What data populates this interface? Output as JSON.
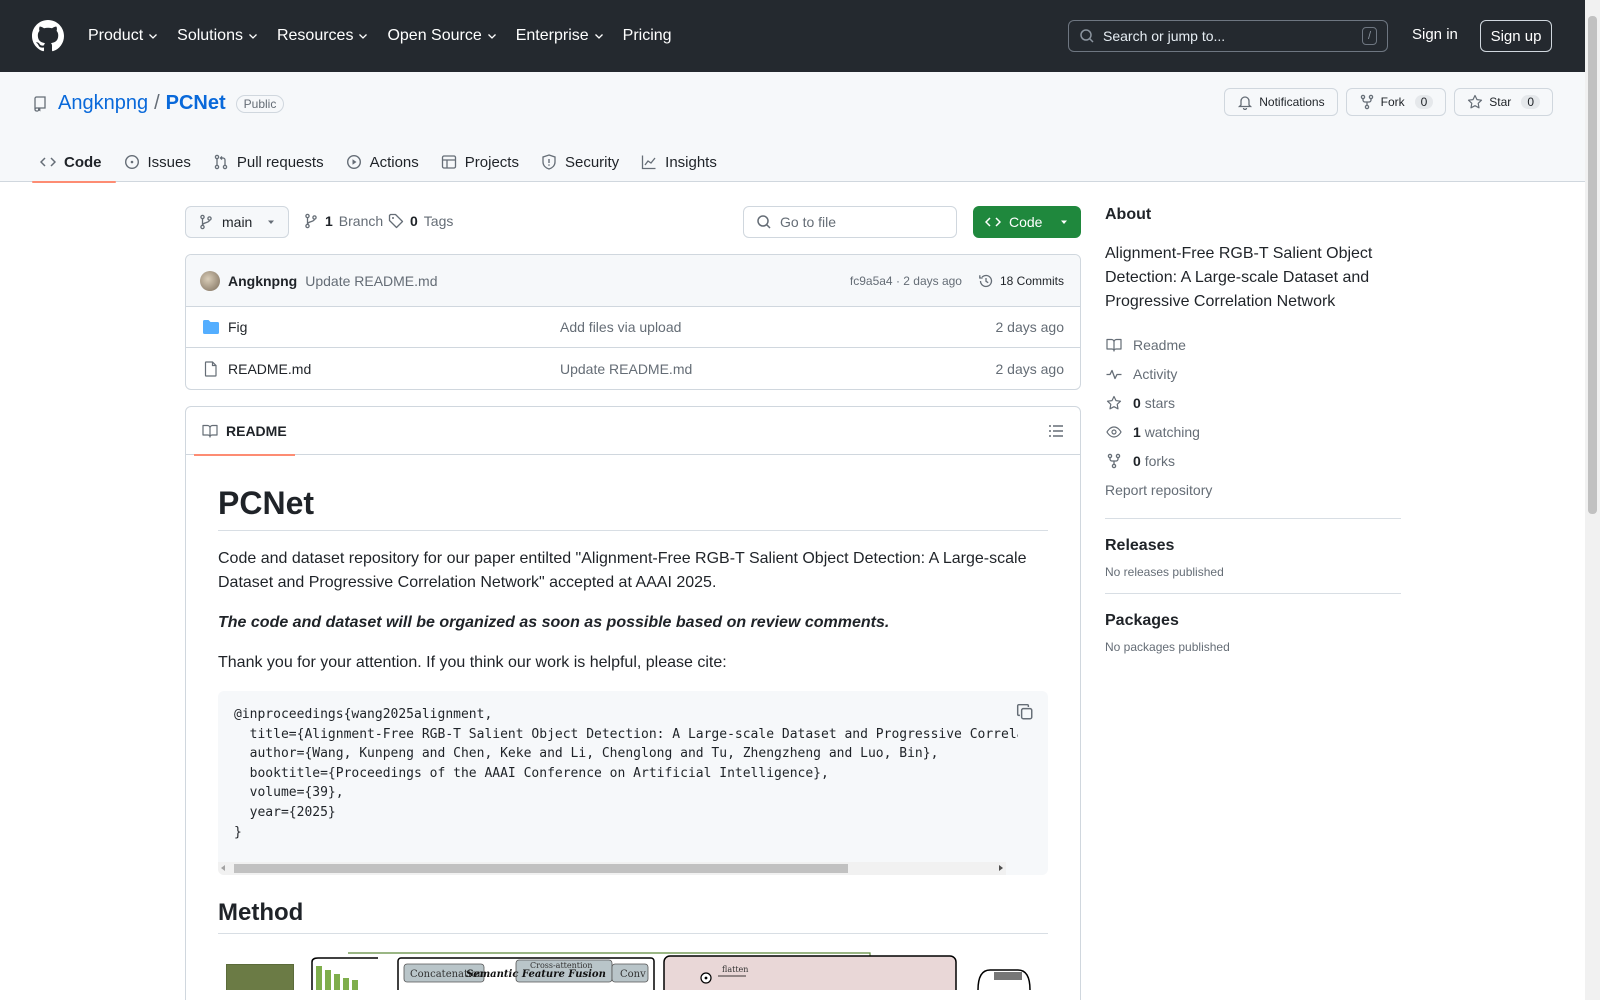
{
  "header": {
    "nav": [
      "Product",
      "Solutions",
      "Resources",
      "Open Source",
      "Enterprise",
      "Pricing"
    ],
    "search_placeholder": "Search or jump to...",
    "search_shortcut": "/",
    "sign_in": "Sign in",
    "sign_up": "Sign up"
  },
  "repo": {
    "owner": "Angknpng",
    "separator": "/",
    "name": "PCNet",
    "visibility": "Public",
    "notifications_label": "Notifications",
    "fork_label": "Fork",
    "fork_count": "0",
    "star_label": "Star",
    "star_count": "0",
    "tabs": [
      "Code",
      "Issues",
      "Pull requests",
      "Actions",
      "Projects",
      "Security",
      "Insights"
    ]
  },
  "toolbar": {
    "branch": "main",
    "branch_count": "1",
    "branch_label": "Branch",
    "tag_count": "0",
    "tag_label": "Tags",
    "goto_placeholder": "Go to file",
    "code_button": "Code"
  },
  "latest_commit": {
    "author": "Angknpng",
    "message": "Update README.md",
    "hash_time": "fc9a5a4 · 2 days ago",
    "commits": "18 Commits"
  },
  "files": [
    {
      "name": "Fig",
      "type": "folder",
      "commit": "Add files via upload",
      "date": "2 days ago"
    },
    {
      "name": "README.md",
      "type": "file",
      "commit": "Update README.md",
      "date": "2 days ago"
    }
  ],
  "readme": {
    "tab_label": "README",
    "title": "PCNet",
    "intro": "Code and dataset repository for our paper entilted \"Alignment-Free RGB-T Salient Object Detection: A Large-scale Dataset and Progressive Correlation Network\" accepted at AAAI 2025.",
    "notice": "The code and dataset will be organized as soon as possible based on review comments.",
    "thanks": "Thank you for your attention. If you think our work is helpful, please cite:",
    "citation": "@inproceedings{wang2025alignment,\n  title={Alignment-Free RGB-T Salient Object Detection: A Large-scale Dataset and Progressive Correlation Network},\n  author={Wang, Kunpeng and Chen, Keke and Li, Chenglong and Tu, Zhengzheng and Luo, Bin},\n  booktitle={Proceedings of the AAAI Conference on Artificial Intelligence},\n  volume={39},\n  year={2025}\n}",
    "method_heading": "Method",
    "figure_labels": [
      "Concatenation",
      "Semantic Feature Fusion",
      "Cross-attention",
      "Conv",
      "flatten"
    ]
  },
  "sidebar": {
    "about_heading": "About",
    "description": "Alignment-Free RGB-T Salient Object Detection: A Large-scale Dataset and Progressive Correlation Network",
    "readme": "Readme",
    "activity": "Activity",
    "stars_count": "0",
    "stars_label": "stars",
    "watching_count": "1",
    "watching_label": "watching",
    "forks_count": "0",
    "forks_label": "forks",
    "report": "Report repository",
    "releases_heading": "Releases",
    "releases_empty": "No releases published",
    "packages_heading": "Packages",
    "packages_empty": "No packages published"
  },
  "colors": {
    "header_bg": "#24292f",
    "link": "#0969da",
    "primary_button": "#1f883d",
    "tab_underline": "#fd8c73"
  }
}
